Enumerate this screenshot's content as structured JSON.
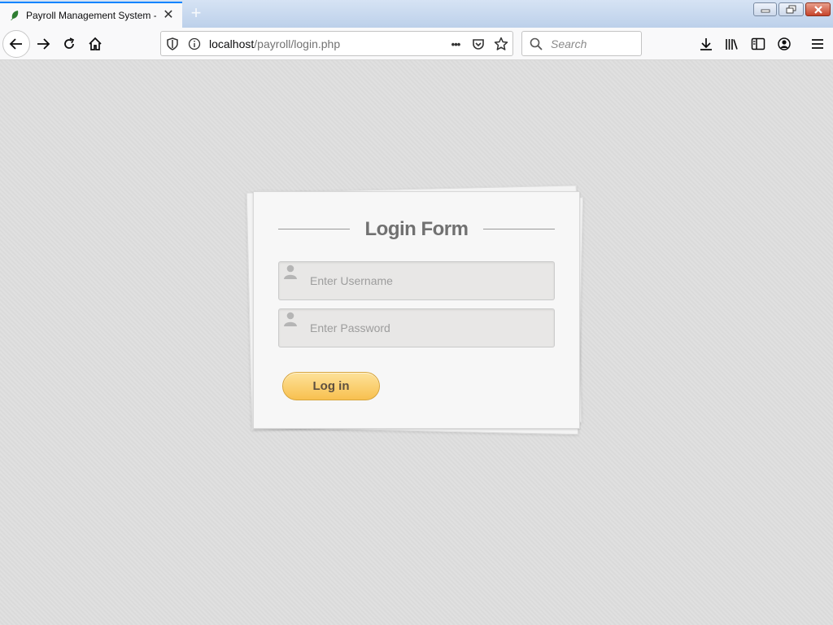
{
  "browser": {
    "tab_title": "Payroll Management System -",
    "tab_close": "✕",
    "new_tab": "+",
    "url_host": "localhost",
    "url_path": "/payroll/login.php",
    "page_actions": "•••",
    "search_placeholder": "Search"
  },
  "login": {
    "heading": "Login Form",
    "username_placeholder": "Enter Username",
    "password_placeholder": "Enter Password",
    "login_button": "Log in"
  },
  "colors": {
    "accent_tab": "#0a84ff",
    "button_gradient_top": "#fde29a",
    "button_gradient_bottom": "#f8c04f",
    "heading_text": "#717171"
  }
}
